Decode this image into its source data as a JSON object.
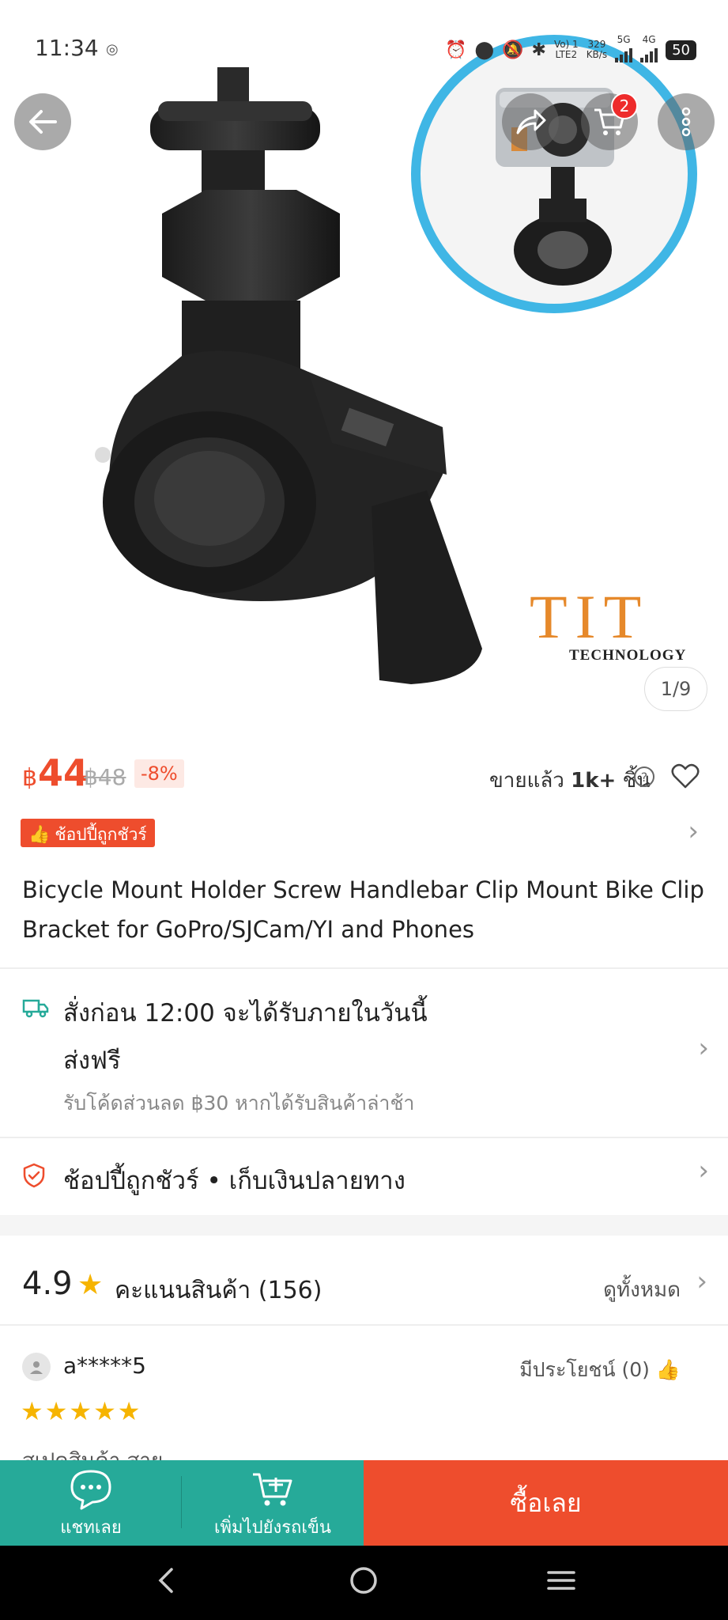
{
  "status_bar": {
    "time": "11:34",
    "net_line1": "Vo) 1",
    "net_line2": "LTE2",
    "speed_line1": "329",
    "speed_line2": "KB/s",
    "sim1": "5G",
    "sim2": "4G",
    "battery": "50"
  },
  "header": {
    "cart_count": "2"
  },
  "gallery": {
    "brand_text": "TIT",
    "brand_sub": "TECHNOLOGY",
    "counter": "1/9"
  },
  "price": {
    "currency": "฿",
    "current": "44",
    "original": "฿48",
    "discount": "-8%",
    "sold_prefix": "ขายแล้ว",
    "sold_count": "1k+",
    "sold_suffix": "ชิ้น"
  },
  "mall_badge": "ช้อปปี้ถูกชัวร์",
  "product_title": "Bicycle Mount Holder Screw Handlebar Clip Mount Bike Clip Bracket for GoPro/SJCam/YI and Phones",
  "shipping": {
    "line1": "สั่งก่อน 12:00 จะได้รับภายในวันนี้",
    "line2": "ส่งฟรี",
    "line3": "รับโค้ดส่วนลด ฿30 หากได้รับสินค้าล่าช้า"
  },
  "guarantee": "ช้อปปี้ถูกชัวร์ • เก็บเงินปลายทาง",
  "rating": {
    "score": "4.9",
    "label": "คะแนนสินค้า (156)",
    "see_all": "ดูทั้งหมด"
  },
  "review": {
    "user": "a*****5",
    "helpful": "มีประโยชน์ (0)",
    "stars": 5,
    "peek": "สเปคสินค้า สาย"
  },
  "bottom_bar": {
    "chat": "แชทเลย",
    "add_cart": "เพิ่มไปยังรถเข็น",
    "buy": "ซื้อเลย"
  },
  "colors": {
    "accent": "#ee4d2d",
    "teal": "#26aa99",
    "star": "#f6b400",
    "ring": "#3fb6e5"
  }
}
